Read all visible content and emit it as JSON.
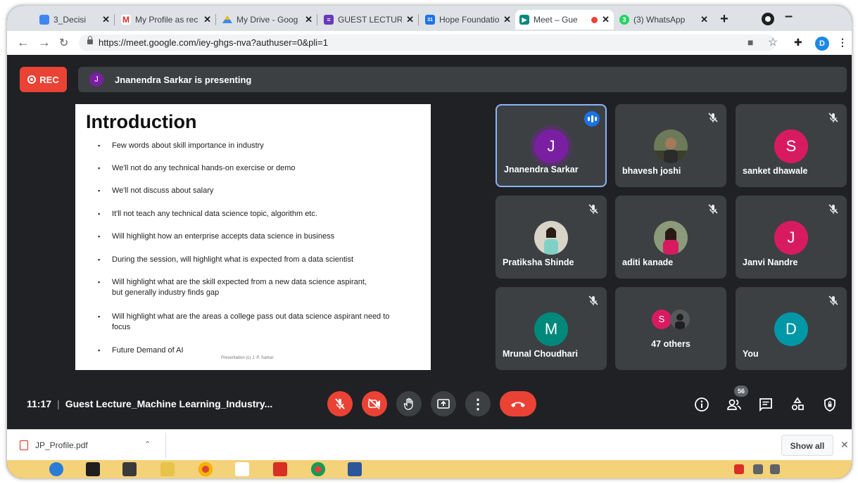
{
  "browser": {
    "tabs": [
      {
        "label": "3_Decisi",
        "icon": "document-icon",
        "color": "#4285f4"
      },
      {
        "label": "My Profile as rec",
        "icon": "gmail-icon",
        "color": "#d93025"
      },
      {
        "label": "My Drive - Goog",
        "icon": "drive-icon",
        "color": "#34a853"
      },
      {
        "label": "GUEST LECTURE",
        "icon": "forms-icon",
        "color": "#673ab7"
      },
      {
        "label": "Hope Foundatio",
        "icon": "calendar-icon",
        "color": "#1a73e8"
      },
      {
        "label": "Meet – Gue",
        "icon": "meet-icon",
        "color": "#00897b"
      },
      {
        "label": "(3) WhatsApp",
        "icon": "whatsapp-icon",
        "color": "#25d366"
      }
    ],
    "url": "https://meet.google.com/iey-ghgs-nva?authuser=0&pli=1",
    "profile_initial": "D"
  },
  "meet": {
    "rec_label": "REC",
    "presenter_initial": "J",
    "presenting_text": "Jnanendra Sarkar is presenting",
    "time": "11:17",
    "meeting_title": "Guest Lecture_Machine Learning_Industry...",
    "participant_count": "56"
  },
  "slide": {
    "title": "Introduction",
    "bullets": [
      "Few words about skill importance in industry",
      "We'll not do any technical hands-on exercise or demo",
      "We'll not discuss about salary",
      "It'll not teach any technical data science topic, algorithm etc.",
      "Will highlight how an enterprise accepts data science in business",
      "During the session, will highlight what is expected from a data scientist",
      "Will highlight what are the skill expected from a new data science aspirant, but generally industry finds gap",
      "Will highlight what are the areas a college pass out data science aspirant need to focus",
      "Future Demand of AI"
    ],
    "footer": "Presentation (c) J. P. Sarkar"
  },
  "participants": [
    {
      "name": "Jnanendra Sarkar",
      "initial": "J",
      "color": "#7b1fa2",
      "speaking": true
    },
    {
      "name": "bhavesh joshi",
      "photo": true,
      "muted": true
    },
    {
      "name": "sanket dhawale",
      "initial": "S",
      "color": "#d81b60",
      "muted": true
    },
    {
      "name": "Pratiksha Shinde",
      "photo": true,
      "muted": true
    },
    {
      "name": "aditi kanade",
      "photo": true,
      "muted": true
    },
    {
      "name": "Janvi Nandre",
      "initial": "J",
      "color": "#d81b60",
      "muted": true
    },
    {
      "name": "Mrunal Choudhari",
      "initial": "M",
      "color": "#00897b",
      "muted": true
    },
    {
      "name": "47 others",
      "initial": "S",
      "color": "#d81b60"
    },
    {
      "name": "You",
      "initial": "D",
      "color": "#0097a7",
      "muted": true
    }
  ],
  "downloads": {
    "file_name": "JP_Profile.pdf",
    "show_all_label": "Show all"
  }
}
